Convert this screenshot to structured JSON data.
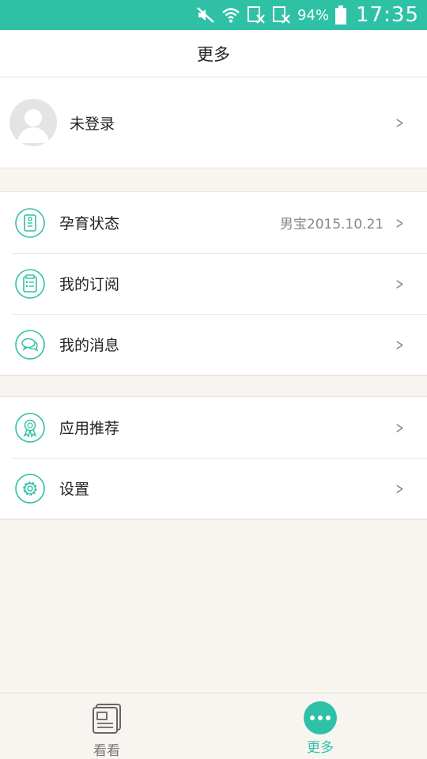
{
  "status_bar": {
    "battery": "94%",
    "time": "17:35",
    "icons": [
      "mute-icon",
      "wifi-icon",
      "sim-icon",
      "sim-icon",
      "battery-icon"
    ]
  },
  "header": {
    "title": "更多"
  },
  "profile": {
    "name": "未登录"
  },
  "group1": [
    {
      "label": "孕育状态",
      "value": "男宝2015.10.21",
      "icon": "pregnancy-icon"
    },
    {
      "label": "我的订阅",
      "icon": "subscription-icon"
    },
    {
      "label": "我的消息",
      "icon": "message-icon"
    }
  ],
  "group2": [
    {
      "label": "应用推荐",
      "icon": "award-icon"
    },
    {
      "label": "设置",
      "icon": "gear-icon"
    }
  ],
  "bottom_nav": [
    {
      "label": "看看",
      "icon": "news-icon",
      "active": false
    },
    {
      "label": "更多",
      "icon": "more-icon",
      "active": true
    }
  ],
  "colors": {
    "accent": "#2fc1a6",
    "background": "#f8f5f1"
  }
}
